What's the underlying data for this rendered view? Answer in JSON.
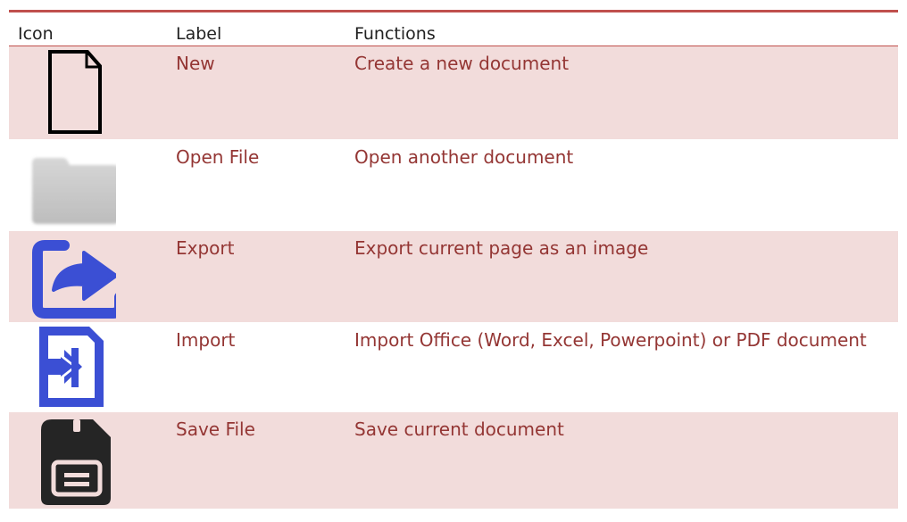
{
  "table": {
    "headers": {
      "icon": "Icon",
      "label": "Label",
      "functions": "Functions"
    },
    "rows": [
      {
        "icon": "new-document-icon",
        "label": "New",
        "function": "Create a new document"
      },
      {
        "icon": "folder-icon",
        "label": "Open File",
        "function": "Open another document"
      },
      {
        "icon": "export-icon",
        "label": "Export",
        "function": "Export current page as an image"
      },
      {
        "icon": "import-icon",
        "label": "Import",
        "function": "Import Office (Word, Excel, Powerpoint) or PDF document"
      },
      {
        "icon": "save-icon",
        "label": "Save File",
        "function": "Save current document"
      }
    ]
  },
  "colors": {
    "accent": "#c0504d",
    "text_red": "#943634",
    "row_shade": "#f2dcdb",
    "icon_blue": "#3b4fd4"
  }
}
